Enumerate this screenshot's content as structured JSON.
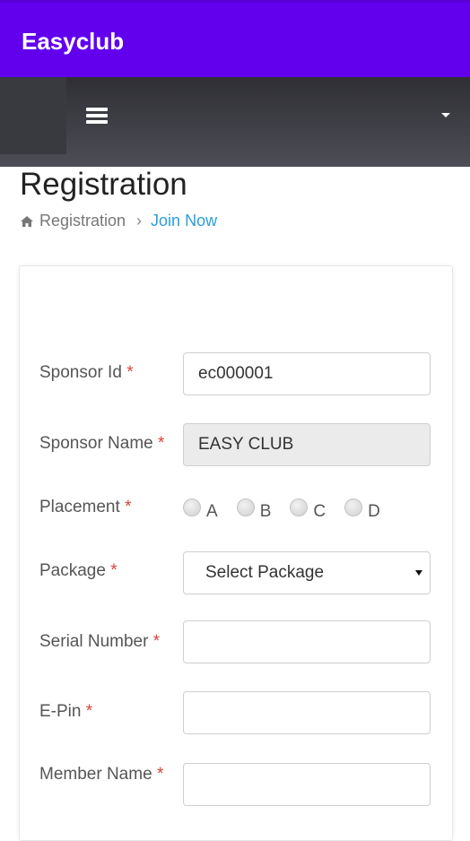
{
  "app": {
    "title": "Easyclub"
  },
  "page": {
    "title": "Registration",
    "breadcrumb": {
      "home": "Registration",
      "current": "Join Now"
    }
  },
  "form": {
    "required_marker": "*",
    "sponsor_id": {
      "label": "Sponsor Id",
      "value": "ec000001"
    },
    "sponsor_name": {
      "label": "Sponsor Name",
      "value": "EASY CLUB"
    },
    "placement": {
      "label": "Placement",
      "options": [
        "A",
        "B",
        "C",
        "D"
      ]
    },
    "package": {
      "label": "Package",
      "selected": "Select Package"
    },
    "serial_number": {
      "label": "Serial Number",
      "value": ""
    },
    "epin": {
      "label": "E-Pin",
      "value": ""
    },
    "member_name": {
      "label": "Member Name",
      "value": ""
    }
  },
  "icons": {
    "menu": "hamburger-menu-icon",
    "dropdown": "chevron-down-icon",
    "home": "home-icon",
    "separator": "chevron-right-icon"
  },
  "colors": {
    "appbar": "#6200ee",
    "navbar": "#3f3f46",
    "link": "#2a9fd6",
    "required": "#d9443a"
  }
}
